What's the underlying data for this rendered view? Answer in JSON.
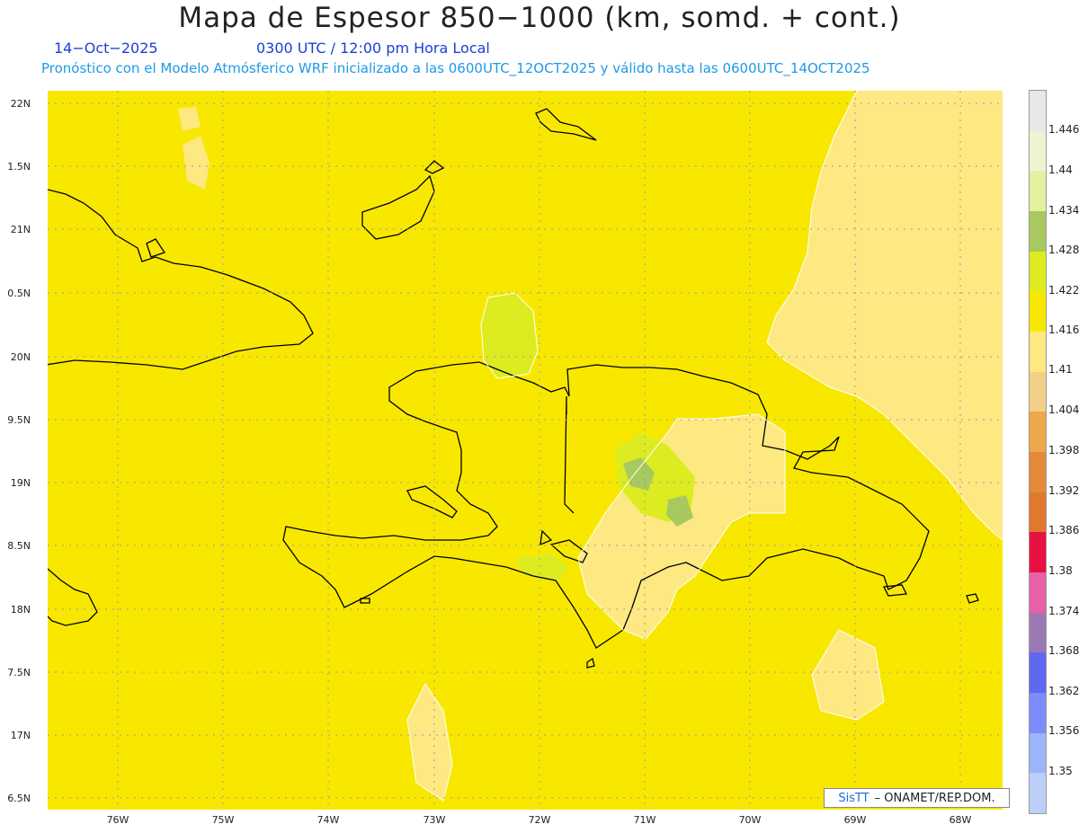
{
  "title": "Mapa de Espesor 850−1000 (km, somd. + cont.)",
  "date": "14−Oct−2025",
  "time": "0300 UTC / 12:00 pm Hora Local",
  "forecast_info": "Pronóstico con el Modelo Atmósferico WRF inicializado a las 0600UTC_12OCT2025 y válido hasta las  0600UTC_14OCT2025",
  "credit": {
    "logo": "SisTT",
    "text": "– ONAMET/REP.DOM."
  },
  "lat_labels": [
    "22N",
    "1.5N",
    "21N",
    "0.5N",
    "20N",
    "9.5N",
    "19N",
    "8.5N",
    "18N",
    "7.5N",
    "17N",
    "6.5N"
  ],
  "lon_labels": [
    "76W",
    "75W",
    "74W",
    "73W",
    "72W",
    "71W",
    "70W",
    "69W",
    "68W"
  ],
  "colorbar": {
    "labels": [
      "1.446",
      "1.44",
      "1.434",
      "1.428",
      "1.422",
      "1.416",
      "1.41",
      "1.404",
      "1.398",
      "1.392",
      "1.386",
      "1.38",
      "1.374",
      "1.368",
      "1.362",
      "1.356",
      "1.35"
    ],
    "colors": [
      "#e8e8e8",
      "#eef4d2",
      "#e4f0a0",
      "#a8c860",
      "#dcec20",
      "#f8e800",
      "#fde882",
      "#f2d088",
      "#eca84a",
      "#e48a3a",
      "#e07830",
      "#e81040",
      "#e860a8",
      "#9c78b4",
      "#6068f0",
      "#7c8cf8",
      "#9cb4f8",
      "#bccff8"
    ]
  },
  "legend_colors": {
    "background_field": "#f8e800",
    "light_field": "#fde882",
    "green_field": "#dcec20",
    "dark_field": "#a8c860",
    "coast": "#000000",
    "contour": "#ffffff"
  }
}
